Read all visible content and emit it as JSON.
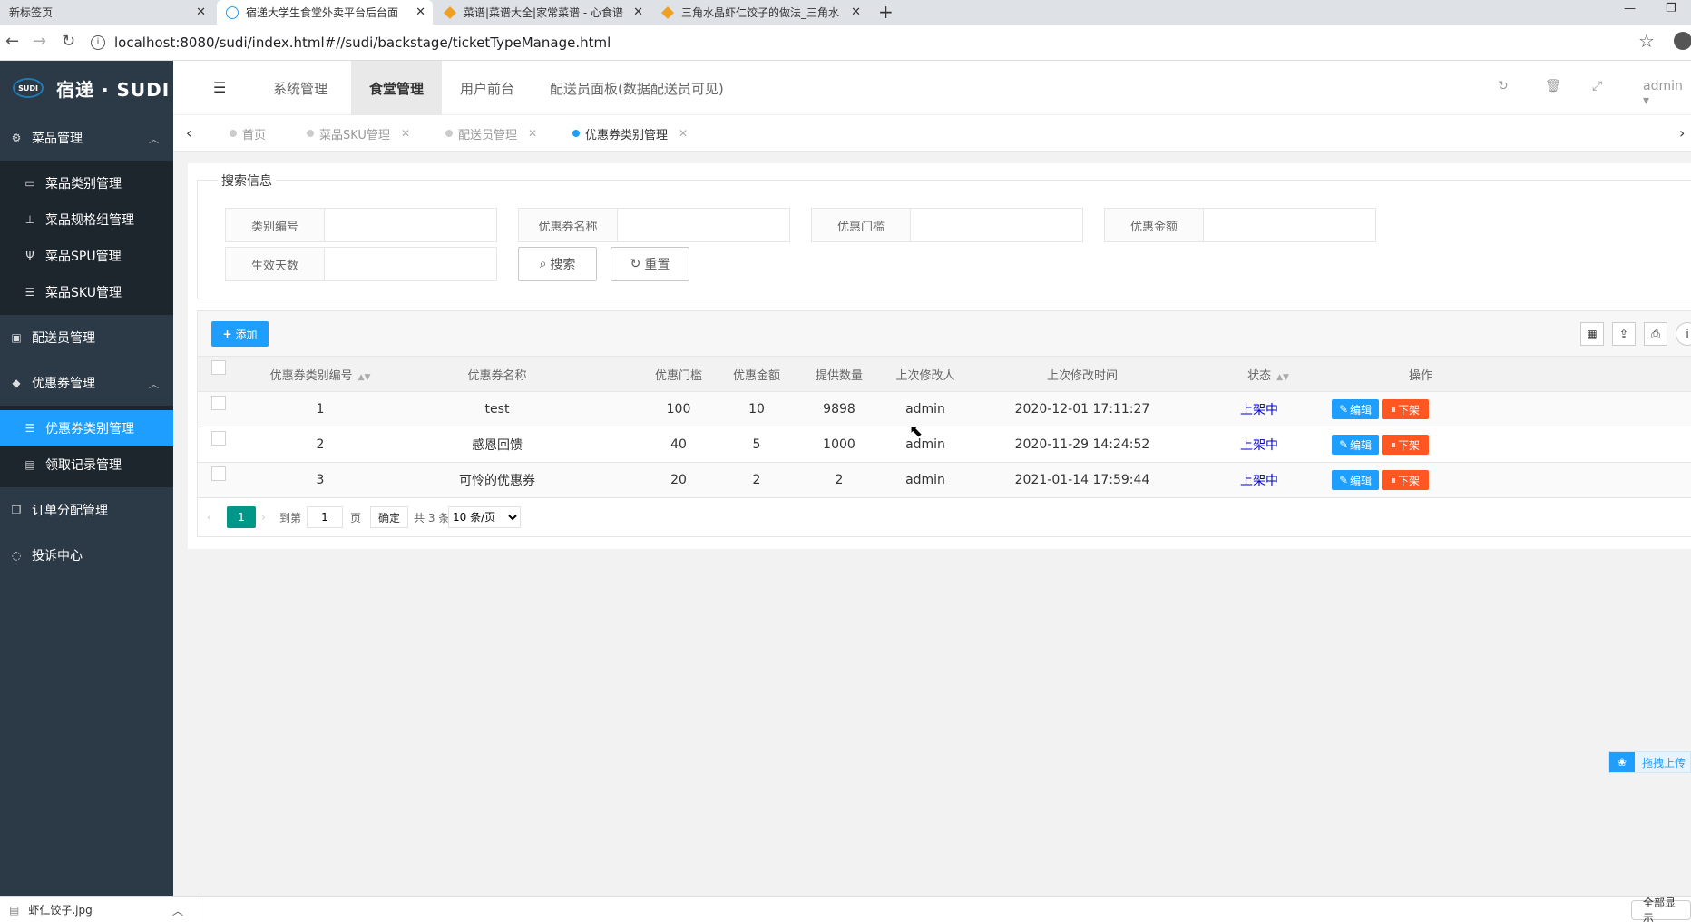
{
  "browser": {
    "tabs": [
      {
        "title": "新标签页",
        "active": false
      },
      {
        "title": "宿递大学生食堂外卖平台后台面",
        "active": true
      },
      {
        "title": "菜谱|菜谱大全|家常菜谱 - 心食谱",
        "active": false
      },
      {
        "title": "三角水晶虾仁饺子的做法_三角水",
        "active": false
      }
    ],
    "url": "localhost:8080/sudi/index.html#//sudi/backstage/ticketTypeManage.html"
  },
  "app": {
    "logo": {
      "mark": "SUDI",
      "name": "宿递 · SUDI"
    },
    "sidebar": {
      "groups": [
        {
          "label": "菜品管理",
          "icon": "gears-icon",
          "expanded": true,
          "items": [
            {
              "label": "菜品类别管理",
              "icon": "inbox-icon"
            },
            {
              "label": "菜品规格组管理",
              "icon": "sitemap-icon"
            },
            {
              "label": "菜品SPU管理",
              "icon": "cutlery-icon"
            },
            {
              "label": "菜品SKU管理",
              "icon": "list-icon"
            }
          ]
        },
        {
          "label": "配送员管理",
          "icon": "briefcase-icon",
          "expanded": false,
          "items": []
        },
        {
          "label": "优惠券管理",
          "icon": "tag-icon",
          "expanded": true,
          "items": [
            {
              "label": "优惠券类别管理",
              "icon": "list-icon",
              "active": true
            },
            {
              "label": "领取记录管理",
              "icon": "file-icon"
            }
          ]
        },
        {
          "label": "订单分配管理",
          "icon": "copy-icon",
          "expanded": false,
          "items": []
        },
        {
          "label": "投诉中心",
          "icon": "chat-icon",
          "expanded": false,
          "items": []
        }
      ]
    },
    "header": {
      "nav": [
        "系统管理",
        "食堂管理",
        "用户前台",
        "配送员面板(数据配送员可见)"
      ],
      "active_nav": "食堂管理",
      "user": "admin"
    },
    "page_tabs": [
      {
        "label": "首页",
        "closable": false,
        "active": false
      },
      {
        "label": "菜品SKU管理",
        "closable": true,
        "active": false
      },
      {
        "label": "配送员管理",
        "closable": true,
        "active": false
      },
      {
        "label": "优惠券类别管理",
        "closable": true,
        "active": true
      }
    ],
    "search": {
      "legend": "搜索信息",
      "fields": [
        {
          "label": "类别编号",
          "value": ""
        },
        {
          "label": "优惠券名称",
          "value": ""
        },
        {
          "label": "优惠门槛",
          "value": ""
        },
        {
          "label": "优惠金额",
          "value": ""
        },
        {
          "label": "生效天数",
          "value": ""
        }
      ],
      "search_btn": "搜索",
      "reset_btn": "重置"
    },
    "table": {
      "add_btn": "添加",
      "columns": [
        "优惠券类别编号",
        "优惠券名称",
        "优惠门槛",
        "优惠金额",
        "提供数量",
        "上次修改人",
        "上次修改时间",
        "状态",
        "操作"
      ],
      "rows": [
        {
          "id": "1",
          "name": "test",
          "threshold": "100",
          "amount": "10",
          "quantity": "9898",
          "modifier": "admin",
          "time": "2020-12-01 17:11:27",
          "status": "上架中"
        },
        {
          "id": "2",
          "name": "感恩回馈",
          "threshold": "40",
          "amount": "5",
          "quantity": "1000",
          "modifier": "admin",
          "time": "2020-11-29 14:24:52",
          "status": "上架中"
        },
        {
          "id": "3",
          "name": "可怜的优惠券",
          "threshold": "20",
          "amount": "2",
          "quantity": "2",
          "modifier": "admin",
          "time": "2021-01-14 17:59:44",
          "status": "上架中"
        }
      ],
      "edit_btn": "编辑",
      "off_btn": "下架",
      "status_color": "#0000cc"
    },
    "pager": {
      "current": "1",
      "goto_label": "到第",
      "goto_value": "1",
      "page_label": "页",
      "confirm": "确定",
      "total": "共 3 条",
      "page_size": "10 条/页"
    },
    "float_widget": "拖拽上传"
  },
  "download_bar": {
    "file": "虾仁饺子.jpg",
    "show_all": "全部显示"
  },
  "colors": {
    "primary": "#1e9fff",
    "danger": "#ff5722",
    "pager": "#009688",
    "sidebar": "#2c3a47"
  }
}
